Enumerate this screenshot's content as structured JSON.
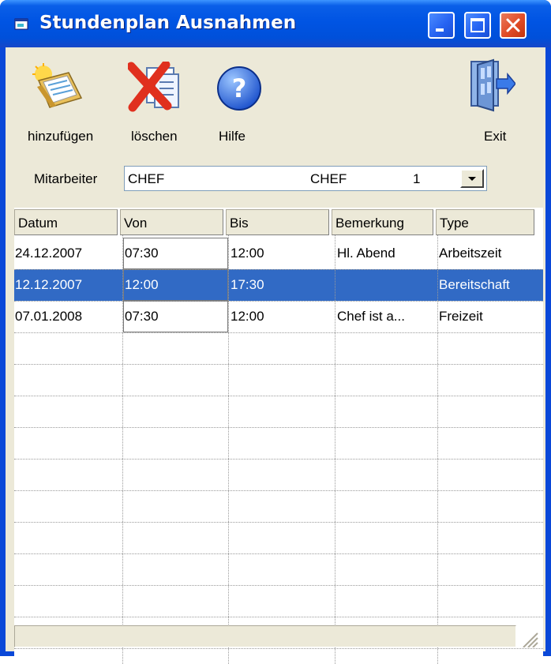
{
  "window": {
    "title": "Stundenplan Ausnahmen",
    "accent_color": "#0054e3"
  },
  "toolbar": {
    "add_label": "hinzufügen",
    "delete_label": "löschen",
    "help_label": "Hilfe",
    "exit_label": "Exit",
    "icons": [
      "add-calendar-icon",
      "delete-icon",
      "help-icon",
      "exit-door-icon"
    ]
  },
  "employee": {
    "label": "Mitarbeiter",
    "name": "CHEF",
    "code": "CHEF",
    "number": "1"
  },
  "table": {
    "columns": [
      "Datum",
      "Von",
      "Bis",
      "Bemerkung",
      "Type"
    ],
    "rows": [
      [
        "24.12.2007",
        "07:30",
        "12:00",
        "Hl. Abend",
        "Arbeitszeit"
      ],
      [
        "12.12.2007",
        "12:00",
        "17:30",
        "",
        "Bereitschaft"
      ],
      [
        "07.01.2008",
        "07:30",
        "12:00",
        "Chef ist a...",
        "Freizeit"
      ]
    ],
    "selected_row": 1,
    "selection_color": "#316ac5"
  }
}
